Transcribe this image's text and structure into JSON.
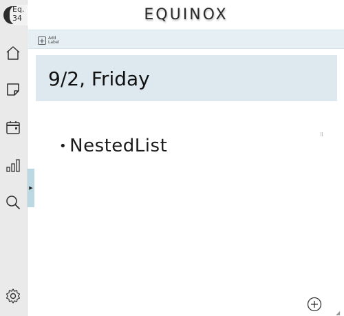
{
  "app": {
    "title": "EQUINOX",
    "logo_text_line1": "Eq.",
    "logo_text_line2": "34"
  },
  "sidebar": {
    "items": [
      {
        "name": "home",
        "icon": "home-icon"
      },
      {
        "name": "notes",
        "icon": "sticky-note-icon"
      },
      {
        "name": "calendar",
        "icon": "calendar-icon"
      },
      {
        "name": "stats",
        "icon": "bar-chart-icon"
      },
      {
        "name": "search",
        "icon": "search-icon"
      }
    ],
    "settings_icon": "gear-icon"
  },
  "toolbar": {
    "add_label_line1": "Add",
    "add_label_line2": "Label",
    "add_icon": "plus-icon"
  },
  "page": {
    "date_heading": "9/2, Friday"
  },
  "content": {
    "list_items": [
      "NestedList"
    ]
  },
  "colors": {
    "accent": "#bcd8e2",
    "header_bg": "#dde9ef",
    "strip_bg": "#e6f0f4",
    "sidebar_bg": "#eaeaea"
  }
}
